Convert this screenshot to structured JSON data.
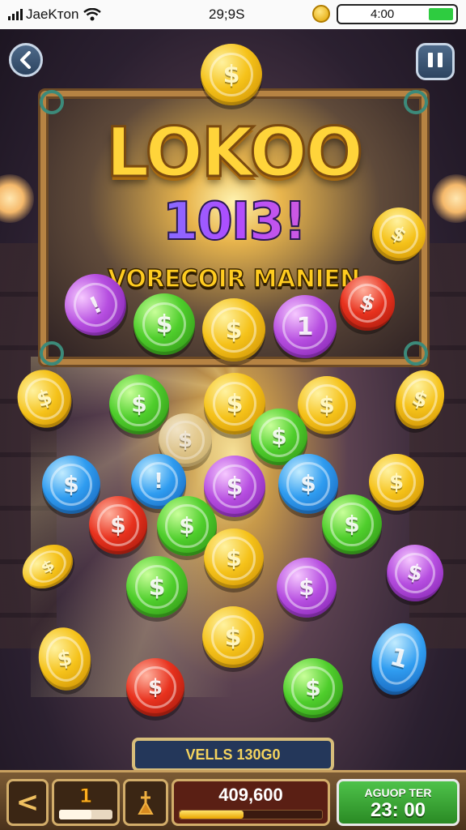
{
  "status_bar": {
    "carrier": "JaeKтon",
    "time": "29;9S",
    "battery_label": "4:00"
  },
  "icons": {
    "back": "chevron-left-icon",
    "pause": "pause-icon",
    "wifi": "wifi-icon",
    "signal": "signal-icon",
    "coin": "coin-icon",
    "tool": "broom-icon"
  },
  "banner": {
    "title": "LOKOO",
    "score_text": "10I3!",
    "subtitle": "VORECOIR MANIEN"
  },
  "coins": {
    "c1": "$",
    "c2": "!",
    "c3": "$",
    "c4": "$",
    "c5": "1",
    "c6": "$",
    "c7": "$",
    "c8": "$",
    "c9": "$",
    "c10": "$",
    "c11": "$",
    "c12": "$",
    "c13": "$",
    "c14": "$",
    "c15": "$",
    "c16": "!",
    "c17": "$",
    "c18": "$",
    "c19": "$",
    "c20": "$",
    "c21": "$",
    "c22": "$",
    "c23": "$",
    "c24": "$",
    "c25": "$",
    "c26": "$",
    "c27": "$",
    "c28": "$",
    "c29": "$",
    "c30": "1",
    "c31": "$",
    "c32": "$"
  },
  "bottom": {
    "label": "VELLS 130G0",
    "back_symbol": "<",
    "level": "1",
    "level_progress": 0.6,
    "score": "409,600",
    "score_progress": 0.45,
    "timer_label": "AGUOP TER",
    "timer_value": "23: 00"
  },
  "colors": {
    "gold": "#f5c21a",
    "green": "#4fce2c",
    "blue": "#2f9cf0",
    "purple": "#b64ee0",
    "red": "#e8321e",
    "frame": "#b68343",
    "timer_green": "#4ec24a"
  }
}
